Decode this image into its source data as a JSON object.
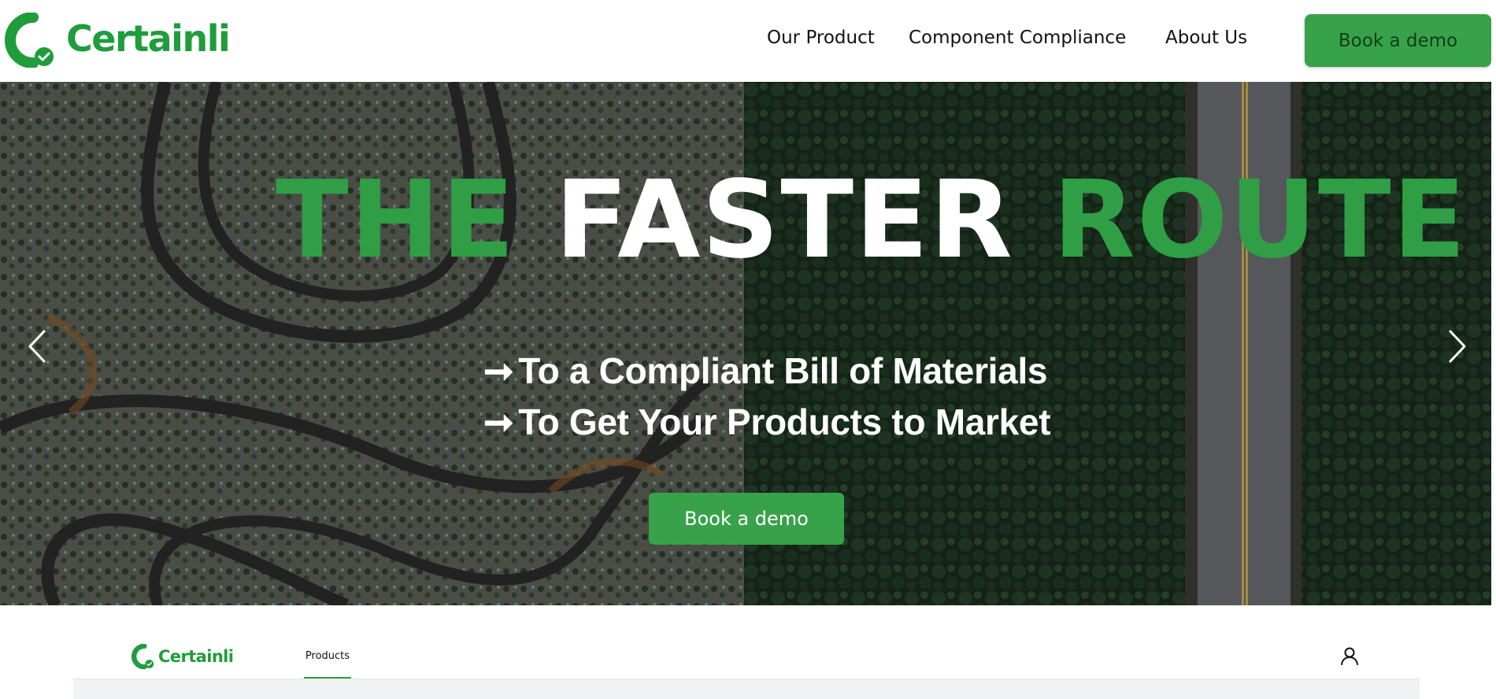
{
  "brand": {
    "name": "Certainli",
    "color": "#1f9d3c"
  },
  "nav": {
    "items": [
      {
        "label": "Our Product"
      },
      {
        "label": "Component Compliance"
      },
      {
        "label": "About Us"
      }
    ],
    "cta_label": "Book a demo"
  },
  "hero": {
    "headline": {
      "word1": "THE",
      "word2": "FASTER",
      "word3": "ROUTE"
    },
    "bullets": [
      {
        "arrow": "➞",
        "text": "To a Compliant Bill of Materials"
      },
      {
        "arrow": "➞",
        "text": "To Get Your Products to Market"
      }
    ],
    "cta_label": "Book a demo",
    "prev_icon": "chevron-left-icon",
    "next_icon": "chevron-right-icon"
  },
  "app": {
    "logo_text": "Certainli",
    "tabs": [
      {
        "label": "Products",
        "active": true
      }
    ],
    "user_icon": "user-icon"
  },
  "colors": {
    "accent": "#38a24a",
    "headline_green": "#2f9e45",
    "text": "#111111"
  }
}
